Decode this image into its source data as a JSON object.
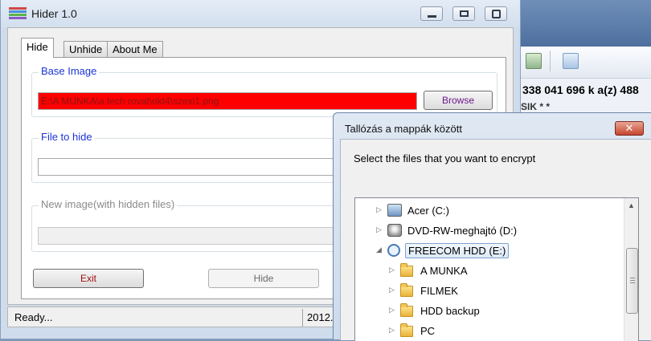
{
  "background_app": {
    "disk_info": "338 041 696 k a(z) 488",
    "sub_text": "SIK * *"
  },
  "hider": {
    "title": "Hider 1.0",
    "tabs": [
      {
        "label": "Hide",
        "active": true
      },
      {
        "label": "Unhide",
        "active": false
      },
      {
        "label": "About Me",
        "active": false
      }
    ],
    "base_image": {
      "legend": "Base Image",
      "value": "E:\\A MUNKA\\a tech rovat\\okt4\\szexi1.png",
      "browse_label": "Browse"
    },
    "file_to_hide": {
      "legend": "File to hide",
      "value": ""
    },
    "new_image": {
      "legend": "New image(with hidden files)",
      "value": ""
    },
    "exit_label": "Exit",
    "hide_label": "Hide",
    "status": {
      "left": "Ready...",
      "right": "2012."
    }
  },
  "dialog": {
    "title": "Tallózás a mappák között",
    "close_label": "✕",
    "prompt": "Select the files that you want to encrypt",
    "tree": [
      {
        "label": "Acer (C:)",
        "icon": "windows-drive-icon",
        "level": 0,
        "expander": "▷",
        "selected": false
      },
      {
        "label": "DVD-RW-meghajtó (D:)",
        "icon": "dvd-drive-icon",
        "level": 0,
        "expander": "▷",
        "selected": false
      },
      {
        "label": "FREECOM HDD (E:)",
        "icon": "external-drive-icon",
        "level": 0,
        "expander": "◢",
        "selected": true
      },
      {
        "label": "A MUNKA",
        "icon": "folder-icon",
        "level": 1,
        "expander": "▷",
        "selected": false
      },
      {
        "label": "FILMEK",
        "icon": "folder-icon",
        "level": 1,
        "expander": "▷",
        "selected": false
      },
      {
        "label": "HDD backup",
        "icon": "folder-icon",
        "level": 1,
        "expander": "▷",
        "selected": false
      },
      {
        "label": "PC",
        "icon": "folder-icon",
        "level": 1,
        "expander": "▷",
        "selected": false
      }
    ]
  },
  "colors": {
    "base_image_field": "#ff0000",
    "legend_blue": "#1b34d6",
    "dialog_close": "#c6452f"
  }
}
